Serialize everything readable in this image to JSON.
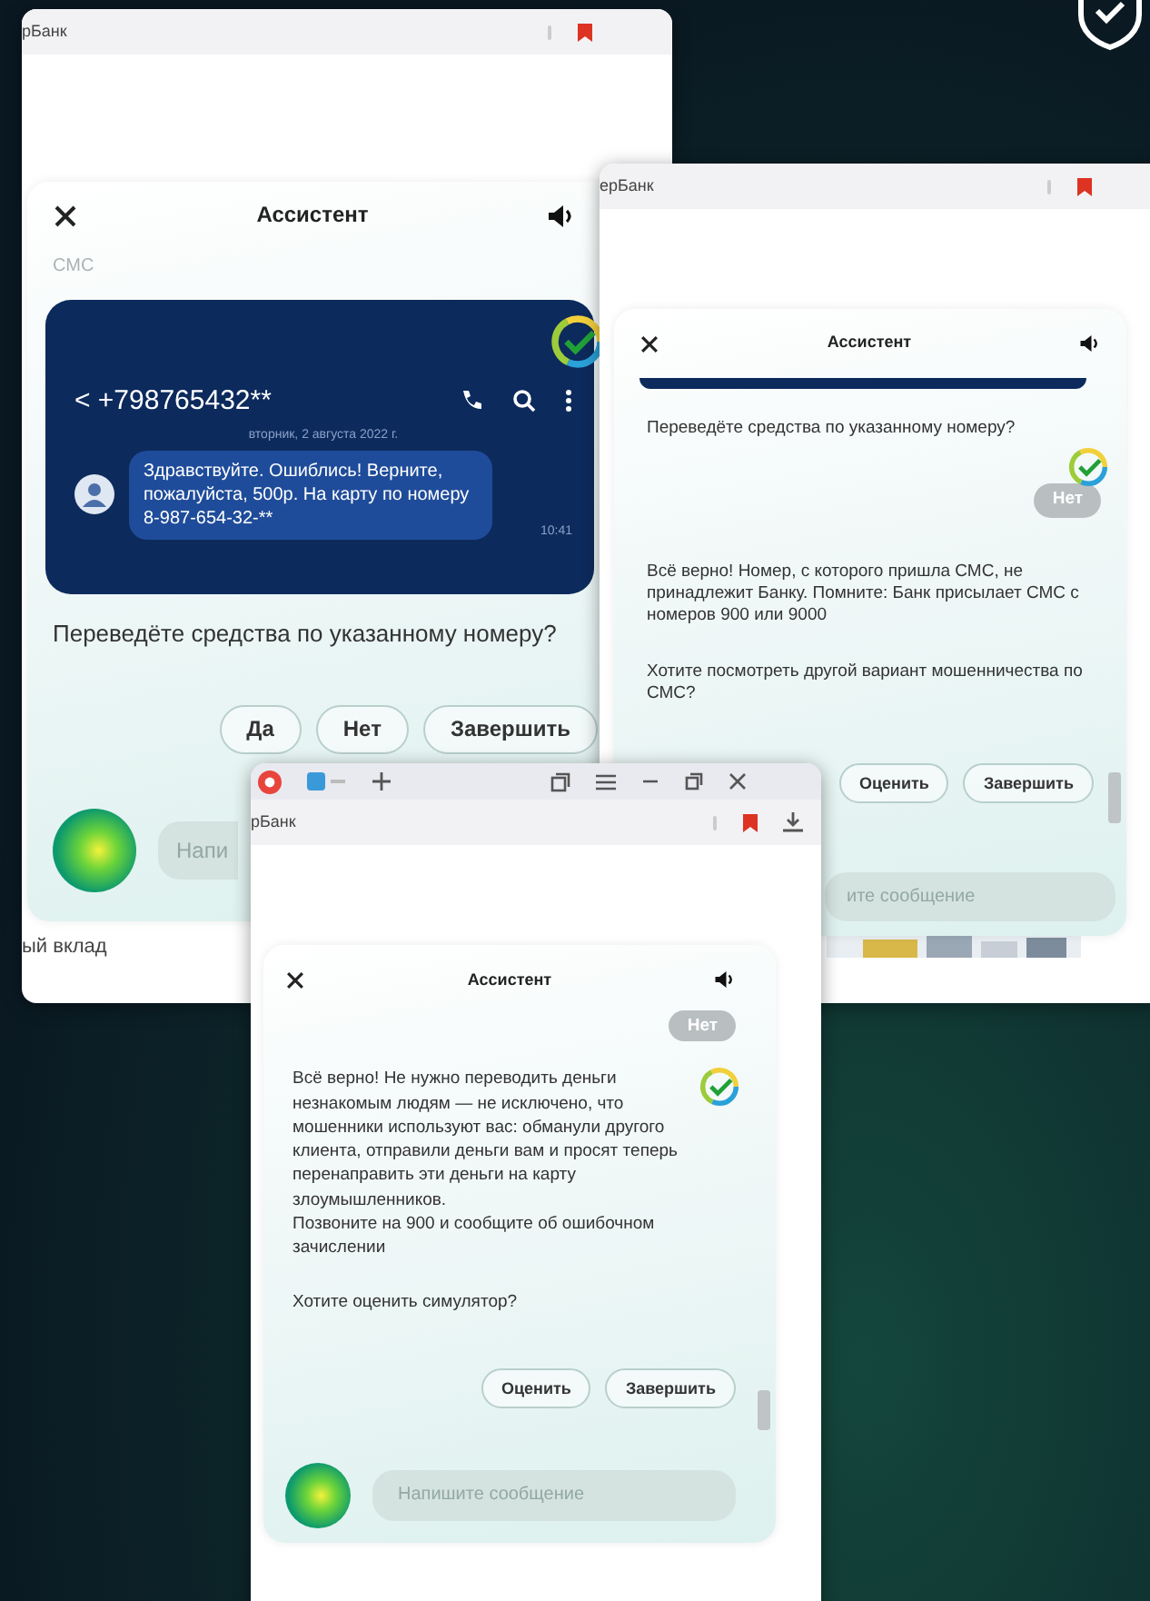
{
  "windows": [
    {
      "kind": "browser",
      "address": "рБанк",
      "title": "Ассистент",
      "chat": [
        {
          "kind": "label",
          "text": "СМС"
        },
        {
          "kind": "sms",
          "logo": true,
          "phone": "< +798765432**",
          "date": "вторник, 2 августа 2022 г.",
          "message": "Здравствуйте. Ошиблись! Верните, пожалуйста, 500р. На карту по номеру 8-987-654-32-**",
          "time": "10:41"
        },
        {
          "kind": "bot",
          "text": "Переведёте средства по указанному номеру?"
        }
      ],
      "buttons": [
        "Да",
        "Нет",
        "Завершить"
      ],
      "avatar": true,
      "input": {
        "placeholder": "Напи"
      },
      "footer": "ый вклад"
    },
    {
      "kind": "browser",
      "address": "ерБанк",
      "title": "Ассистент",
      "chat": [
        {
          "kind": "card-edge"
        },
        {
          "kind": "bot",
          "text": "Переведёте средства по указанному номеру?"
        },
        {
          "kind": "user",
          "logo": true,
          "text": "Нет"
        },
        {
          "kind": "bot",
          "text": "Всё верно! Номер, с которого пришла СМС, не принадлежит Банку. Помните: Банк присылает СМС с номеров 900 или 9000"
        },
        {
          "kind": "bot",
          "text": "Хотите посмотреть другой вариант мошенничества по СМС?"
        }
      ],
      "buttons": [
        "Оценить",
        "Завершить"
      ],
      "scrollbar": true,
      "input": {
        "placeholder": "ите сообщение"
      },
      "footer_picture": true
    },
    {
      "kind": "tabbed",
      "address": "рБанк",
      "title": "Ассистент",
      "chat": [
        {
          "kind": "user",
          "text": "Нет"
        },
        {
          "kind": "bot",
          "logo": true,
          "text": "Всё верно! Не нужно переводить деньги незнакомым людям — не исключено, что мошенники используют вас: обманули другого клиента, отправили деньги вам и просят теперь перенаправить эти деньги на карту злоумышленников.\nПозвоните на 900 и сообщите об ошибочном зачислении"
        },
        {
          "kind": "bot",
          "text": "Хотите оценить симулятор?"
        }
      ],
      "buttons": [
        "Оценить",
        "Завершить"
      ],
      "scrollbar": true,
      "avatar": true,
      "input": {
        "placeholder": "Напишите сообщение"
      }
    }
  ]
}
